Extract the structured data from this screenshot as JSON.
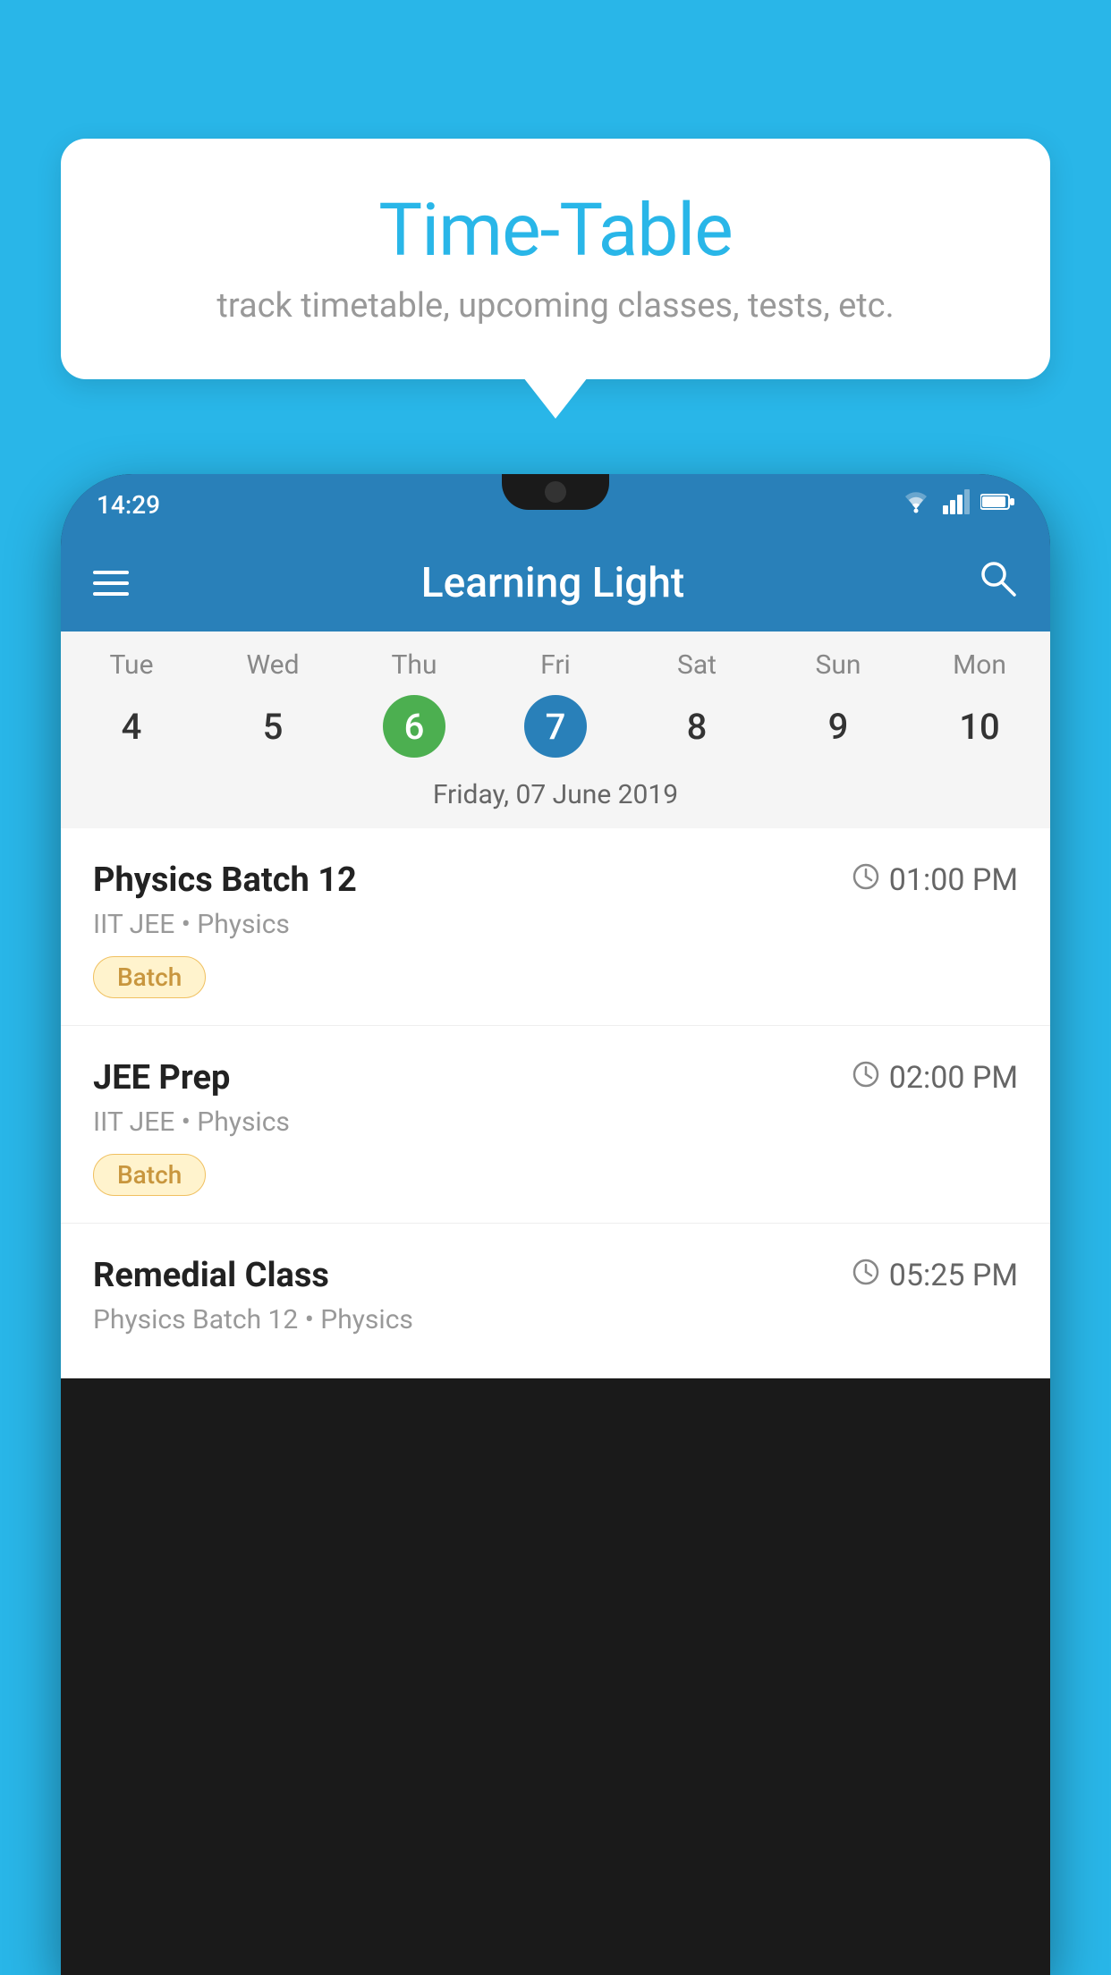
{
  "page": {
    "background_color": "#29b6e8"
  },
  "speech_bubble": {
    "title": "Time-Table",
    "subtitle": "track timetable, upcoming classes, tests, etc."
  },
  "phone": {
    "status_bar": {
      "time": "14:29",
      "icons": [
        "wifi",
        "signal",
        "battery"
      ]
    },
    "app_bar": {
      "title": "Learning Light",
      "menu_icon": "hamburger",
      "search_icon": "search"
    },
    "calendar": {
      "days": [
        {
          "name": "Tue",
          "number": "4",
          "state": "normal"
        },
        {
          "name": "Wed",
          "number": "5",
          "state": "normal"
        },
        {
          "name": "Thu",
          "number": "6",
          "state": "today"
        },
        {
          "name": "Fri",
          "number": "7",
          "state": "selected"
        },
        {
          "name": "Sat",
          "number": "8",
          "state": "normal"
        },
        {
          "name": "Sun",
          "number": "9",
          "state": "normal"
        },
        {
          "name": "Mon",
          "number": "10",
          "state": "normal"
        }
      ],
      "selected_date_label": "Friday, 07 June 2019"
    },
    "schedule_items": [
      {
        "title": "Physics Batch 12",
        "time": "01:00 PM",
        "subtitle": "IIT JEE • Physics",
        "badge": "Batch"
      },
      {
        "title": "JEE Prep",
        "time": "02:00 PM",
        "subtitle": "IIT JEE • Physics",
        "badge": "Batch"
      },
      {
        "title": "Remedial Class",
        "time": "05:25 PM",
        "subtitle": "Physics Batch 12 • Physics",
        "badge": ""
      }
    ]
  }
}
